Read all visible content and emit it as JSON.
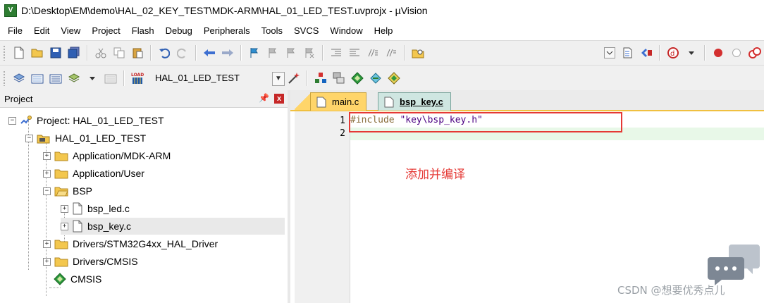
{
  "window": {
    "title": "D:\\Desktop\\EM\\demo\\HAL_02_KEY_TEST\\MDK-ARM\\HAL_01_LED_TEST.uvprojx - µVision",
    "app_icon_letter": "V"
  },
  "menu": [
    "File",
    "Edit",
    "View",
    "Project",
    "Flash",
    "Debug",
    "Peripherals",
    "Tools",
    "SVCS",
    "Window",
    "Help"
  ],
  "toolbar2": {
    "target_name": "HAL_01_LED_TEST",
    "load_label": "LOAD"
  },
  "project_panel": {
    "title": "Project",
    "tree": {
      "root": "Project: HAL_01_LED_TEST",
      "target": "HAL_01_LED_TEST",
      "groups": [
        {
          "label": "Application/MDK-ARM"
        },
        {
          "label": "Application/User"
        },
        {
          "label": "BSP"
        },
        {
          "label": "Drivers/STM32G4xx_HAL_Driver"
        },
        {
          "label": "Drivers/CMSIS"
        }
      ],
      "bsp_files": [
        "bsp_led.c",
        "bsp_key.c"
      ],
      "cmsis": "CMSIS"
    }
  },
  "editor": {
    "tabs": [
      {
        "label": "main.c"
      },
      {
        "label": "bsp_key.c"
      }
    ],
    "line_numbers": [
      "1",
      "2"
    ],
    "code": {
      "line1_directive": "#include",
      "line1_string": "\"key\\bsp_key.h\""
    }
  },
  "annotation": "添加并编译",
  "watermark": "CSDN @想要优秀点儿",
  "colors": {
    "highlight_box": "#e53935",
    "annotation_text": "#e53935",
    "tab_active_bg": "#cfe6e1",
    "tab_inactive_bg": "#ffd56a"
  }
}
